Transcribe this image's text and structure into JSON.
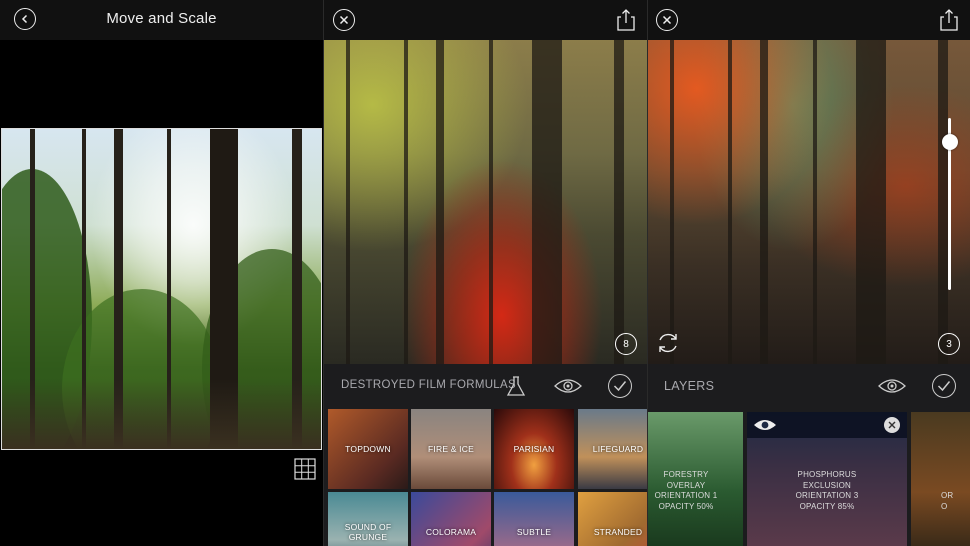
{
  "panel1": {
    "title": "Move and Scale",
    "back_icon": "chevron-left-icon",
    "grid_icon": "grid-icon"
  },
  "panel2": {
    "close_icon": "close-icon",
    "share_icon": "share-icon",
    "filter_count": "8",
    "formula_label": "DESTROYED FILM FORMULAS",
    "lab_icon": "flask-icon",
    "preview_icon": "eye-icon",
    "confirm_icon": "checkmark-icon",
    "filters": [
      {
        "label": "TOPDOWN",
        "color": "#8a3a2a"
      },
      {
        "label": "FIRE & ICE",
        "color": "#6f6a64"
      },
      {
        "label": "PARISIAN",
        "color": "#c04a20"
      },
      {
        "label": "LIFEGUARD",
        "color": "#5a6878"
      },
      {
        "label": "SOUND OF\nGRUNGE",
        "color": "#4a7f8a"
      },
      {
        "label": "COLORAMA",
        "color": "#5b4a8a"
      },
      {
        "label": "SUBTLE",
        "color": "#3c5a8a"
      },
      {
        "label": "STRANDED",
        "color": "#b08040"
      }
    ]
  },
  "panel3": {
    "close_icon": "close-icon",
    "share_icon": "share-icon",
    "rotate_icon": "rotate-icon",
    "layer_count": "3",
    "slider_value": 0.86,
    "layers_label": "LAYERS",
    "preview_icon": "eye-icon",
    "confirm_icon": "checkmark-icon",
    "layers": [
      {
        "text": "FORESTRY\nOVERLAY\nORIENTATION 1\nOPACITY 50%",
        "color": "#2f5a2e"
      },
      {
        "text": "PHOSPHORUS\nEXCLUSION\nORIENTATION 3\nOPACITY 85%",
        "color": "#3a2f3a"
      },
      {
        "text": "OR\nO",
        "color": "#5a3a1e"
      }
    ]
  }
}
